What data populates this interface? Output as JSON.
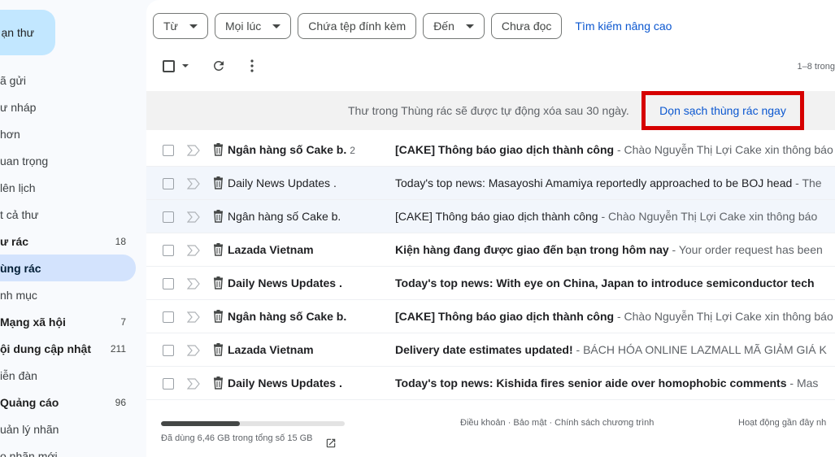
{
  "sidebar": {
    "compose_label": "ạn thư",
    "items": [
      {
        "label": "ã gửi",
        "count": "",
        "style": "normal"
      },
      {
        "label": "ư nháp",
        "count": "",
        "style": "normal"
      },
      {
        "label": "hơn",
        "count": "",
        "style": "normal"
      },
      {
        "label": "uan trọng",
        "count": "",
        "style": "normal"
      },
      {
        "label": "lên lịch",
        "count": "",
        "style": "normal"
      },
      {
        "label": "t cả thư",
        "count": "",
        "style": "normal"
      },
      {
        "label": "ư rác",
        "count": "18",
        "style": "bold"
      },
      {
        "label": "ùng rác",
        "count": "",
        "style": "active"
      },
      {
        "label": "nh mục",
        "count": "",
        "style": "normal"
      },
      {
        "label": "Mạng xã hội",
        "count": "7",
        "style": "bold"
      },
      {
        "label": "ội dung cập nhật",
        "count": "211",
        "style": "bold"
      },
      {
        "label": "iễn đàn",
        "count": "",
        "style": "normal"
      },
      {
        "label": "Quảng cáo",
        "count": "96",
        "style": "bold"
      },
      {
        "label": "uản lý nhãn",
        "count": "",
        "style": "normal"
      },
      {
        "label": "o nhãn mới",
        "count": "",
        "style": "normal"
      }
    ]
  },
  "filters": {
    "from": "Từ",
    "any_time": "Mọi lúc",
    "has_attachment": "Chứa tệp đính kèm",
    "to": "Đến",
    "unread": "Chưa đọc",
    "advanced_search": "Tìm kiếm nâng cao"
  },
  "toolbar": {
    "page_info": "1–8 trong"
  },
  "banner": {
    "text": "Thư trong Thùng rác sẽ được tự động xóa sau 30 ngày.",
    "empty_trash": "Dọn sạch thùng rác ngay"
  },
  "messages": [
    {
      "sender": "Ngân hàng số Cake b.",
      "count": "2",
      "subject": "[CAKE] Thông báo giao dịch thành công",
      "snippet": " - Chào Nguyễn Thị Lợi Cake xin thông báo",
      "unread": true
    },
    {
      "sender": "Daily News Updates .",
      "count": "",
      "subject": "Today's top news: Masayoshi Amamiya reportedly approached to be BOJ head",
      "snippet": " - The",
      "unread": false
    },
    {
      "sender": "Ngân hàng số Cake b.",
      "count": "",
      "subject": "[CAKE] Thông báo giao dịch thành công",
      "snippet": " - Chào Nguyễn Thị Lợi Cake xin thông báo",
      "unread": false
    },
    {
      "sender": "Lazada Vietnam",
      "count": "",
      "subject": "Kiện hàng đang được giao đến bạn trong hôm nay",
      "snippet": " - Your order request has been",
      "unread": true
    },
    {
      "sender": "Daily News Updates .",
      "count": "",
      "subject": "Today's top news: With eye on China, Japan to introduce semiconductor tech",
      "snippet": "",
      "unread": true
    },
    {
      "sender": "Ngân hàng số Cake b.",
      "count": "",
      "subject": "[CAKE] Thông báo giao dịch thành công",
      "snippet": " - Chào Nguyễn Thị Lợi Cake xin thông báo",
      "unread": true
    },
    {
      "sender": "Lazada Vietnam",
      "count": "",
      "subject": "Delivery date estimates updated!",
      "snippet": " - BÁCH HÓA ONLINE LAZMALL MÃ GIẢM GIÁ K",
      "unread": true
    },
    {
      "sender": "Daily News Updates .",
      "count": "",
      "subject": "Today's top news: Kishida fires senior aide over homophobic comments",
      "snippet": " - Mas",
      "unread": true
    }
  ],
  "footer": {
    "storage_text": "Đã dùng 6,46 GB trong tổng số 15 GB",
    "storage_fraction": 0.43,
    "links": "Điều khoản · Bảo mật · Chính sách chương trình",
    "activity": "Hoạt động gần đây nh"
  }
}
